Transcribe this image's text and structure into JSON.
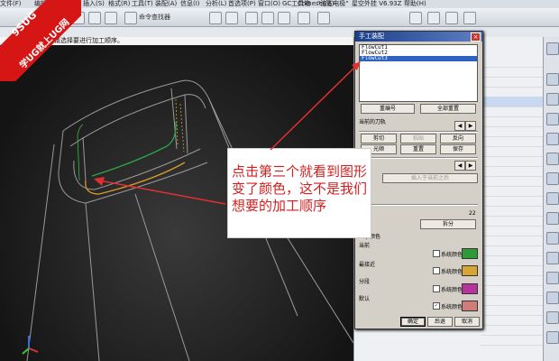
{
  "menubar": {
    "items": [
      "文件(F)",
      "编辑(E)",
      "视图(V)",
      "插入(S)",
      "格式(R)",
      "工具(T)",
      "装配(A)",
      "信息(I)",
      "分析(L)",
      "首选项(P)",
      "窗口(O)",
      "GC工具箱",
      "Chinese(简)",
      "\"渲五电极\"",
      "星空外挂 V6.93Z",
      "帮助(H)"
    ]
  },
  "toolbar": {
    "command_finder": "命令查找器"
  },
  "cue_line": "请选择要进行加工顺序。",
  "logo": {
    "line1": "9SUG",
    "line2": "学UG就上UG网"
  },
  "dialog": {
    "title": "手工装配",
    "list_items": [
      "FlowCut1",
      "FlowCut2",
      "FlowCut3"
    ],
    "selected_index": 2,
    "renumber": "重编号",
    "reset_all": "全部重置",
    "current_label": "当前的刀轨",
    "cut": "剪切",
    "paste": "粘贴",
    "reverse": "反向",
    "smooth": "光顺",
    "reset": "重置",
    "save": "保存",
    "insert_after": "插入于当前之后",
    "count": "22",
    "split": "拆分",
    "colors_title": "显示颜色",
    "color_rows": [
      {
        "label": "当前",
        "sys": "系统颜色",
        "color": "#2f9a3a",
        "checked": false
      },
      {
        "label": "最接近",
        "sys": "系统颜色",
        "color": "#d9a532",
        "checked": false
      },
      {
        "label": "分段",
        "sys": "系统颜色",
        "color": "#b9329e",
        "checked": false
      },
      {
        "label": "默认",
        "sys": "系统颜色",
        "color": "#d27b7b",
        "checked": true
      }
    ],
    "ok": "确定",
    "back": "后退",
    "cancel": "取消"
  },
  "annotation": {
    "text": "点击第三个就看到图形变了颜色，这不是我们想要的加工顺序",
    "color": "#d41f1f"
  },
  "colors": {
    "viewport_bg": "#1c1c1c",
    "selection": "#2d62c1",
    "arrow": "#e03030"
  }
}
